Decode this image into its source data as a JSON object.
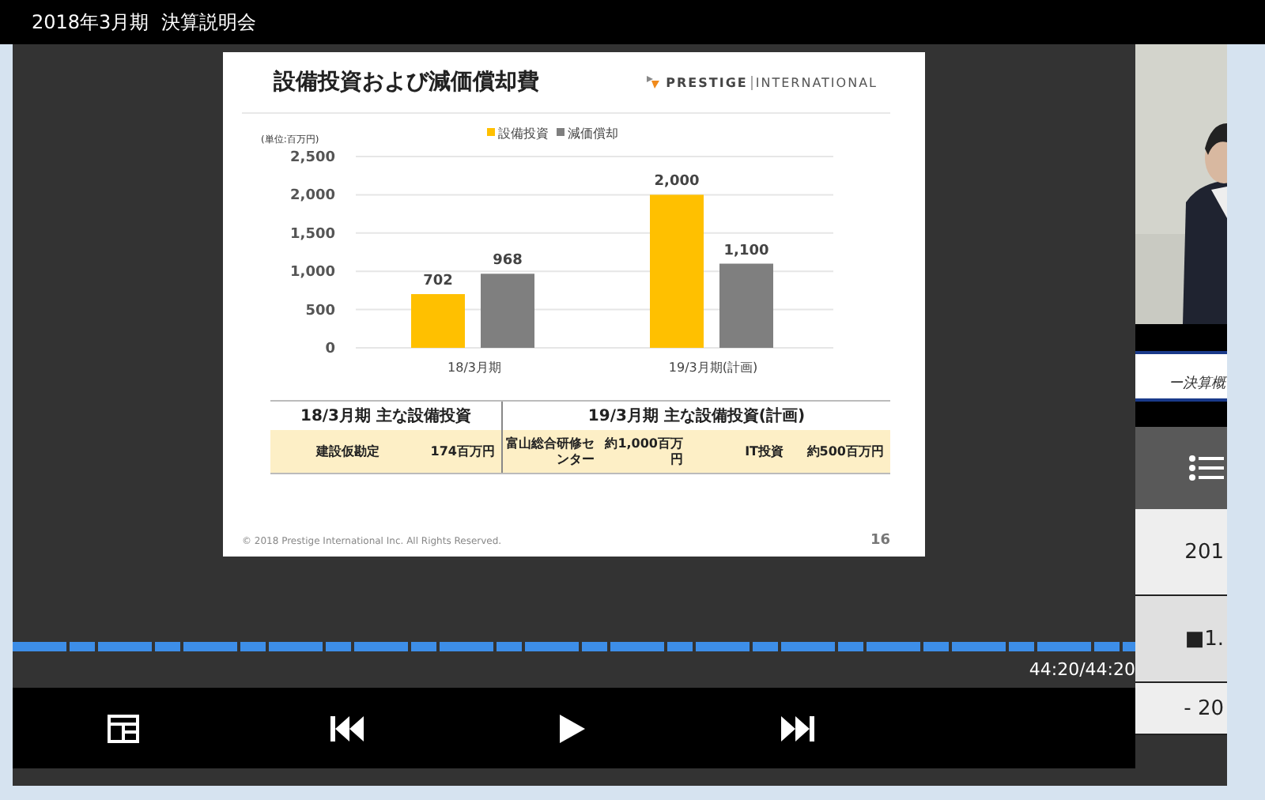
{
  "window": {
    "title": "2018年3月期  決算説明会"
  },
  "slide": {
    "title": "設備投資および減価償却費",
    "logo": {
      "brand": "PRESTIGE",
      "suffix": "INTERNATIONAL"
    },
    "chart": {
      "chart_data": {
        "type": "bar",
        "ylabel": "(単位:百万円)",
        "categories": [
          "18/3月期",
          "19/3月期(計画)"
        ],
        "series": [
          {
            "name": "設備投資",
            "color": "#ffc000",
            "values": [
              702,
              2000
            ]
          },
          {
            "name": "減価償却",
            "color": "#7f7f7f",
            "values": [
              968,
              1100
            ]
          }
        ],
        "ylim": [
          0,
          2500
        ],
        "yticks": [
          {
            "value": 0,
            "label": "0"
          },
          {
            "value": 500,
            "label": "500"
          },
          {
            "value": 1000,
            "label": "1,000"
          },
          {
            "value": 1500,
            "label": "1,500"
          },
          {
            "value": 2000,
            "label": "2,000"
          },
          {
            "value": 2500,
            "label": "2,500"
          }
        ],
        "value_labels": [
          "702",
          "2,000",
          "968",
          "1,100"
        ],
        "grid": true,
        "legend": "top"
      }
    },
    "table": {
      "groups": [
        {
          "header": "18/3月期 主な設備投資",
          "cells": [
            "建設仮勘定",
            "174百万円"
          ]
        },
        {
          "header": "19/3月期 主な設備投資(計画)",
          "cells": [
            "富山総合研修センター",
            "約1,000百万円",
            "IT投資",
            "約500百万円"
          ]
        }
      ]
    },
    "footer": "© 2018 Prestige International Inc. All Rights Reserved.",
    "page_number": "16"
  },
  "player": {
    "progress": {
      "level": 1
    },
    "time": "44:20/44:20",
    "controls": [
      {
        "kind": "layout"
      },
      {
        "kind": "previous"
      },
      {
        "kind": "play"
      },
      {
        "kind": "next"
      }
    ]
  },
  "side": {
    "banner": "ー決算概",
    "chapters": [
      {
        "label": "201",
        "selected": false
      },
      {
        "label": "■1.",
        "selected": true
      },
      {
        "label": "- 20",
        "selected": false
      }
    ]
  }
}
